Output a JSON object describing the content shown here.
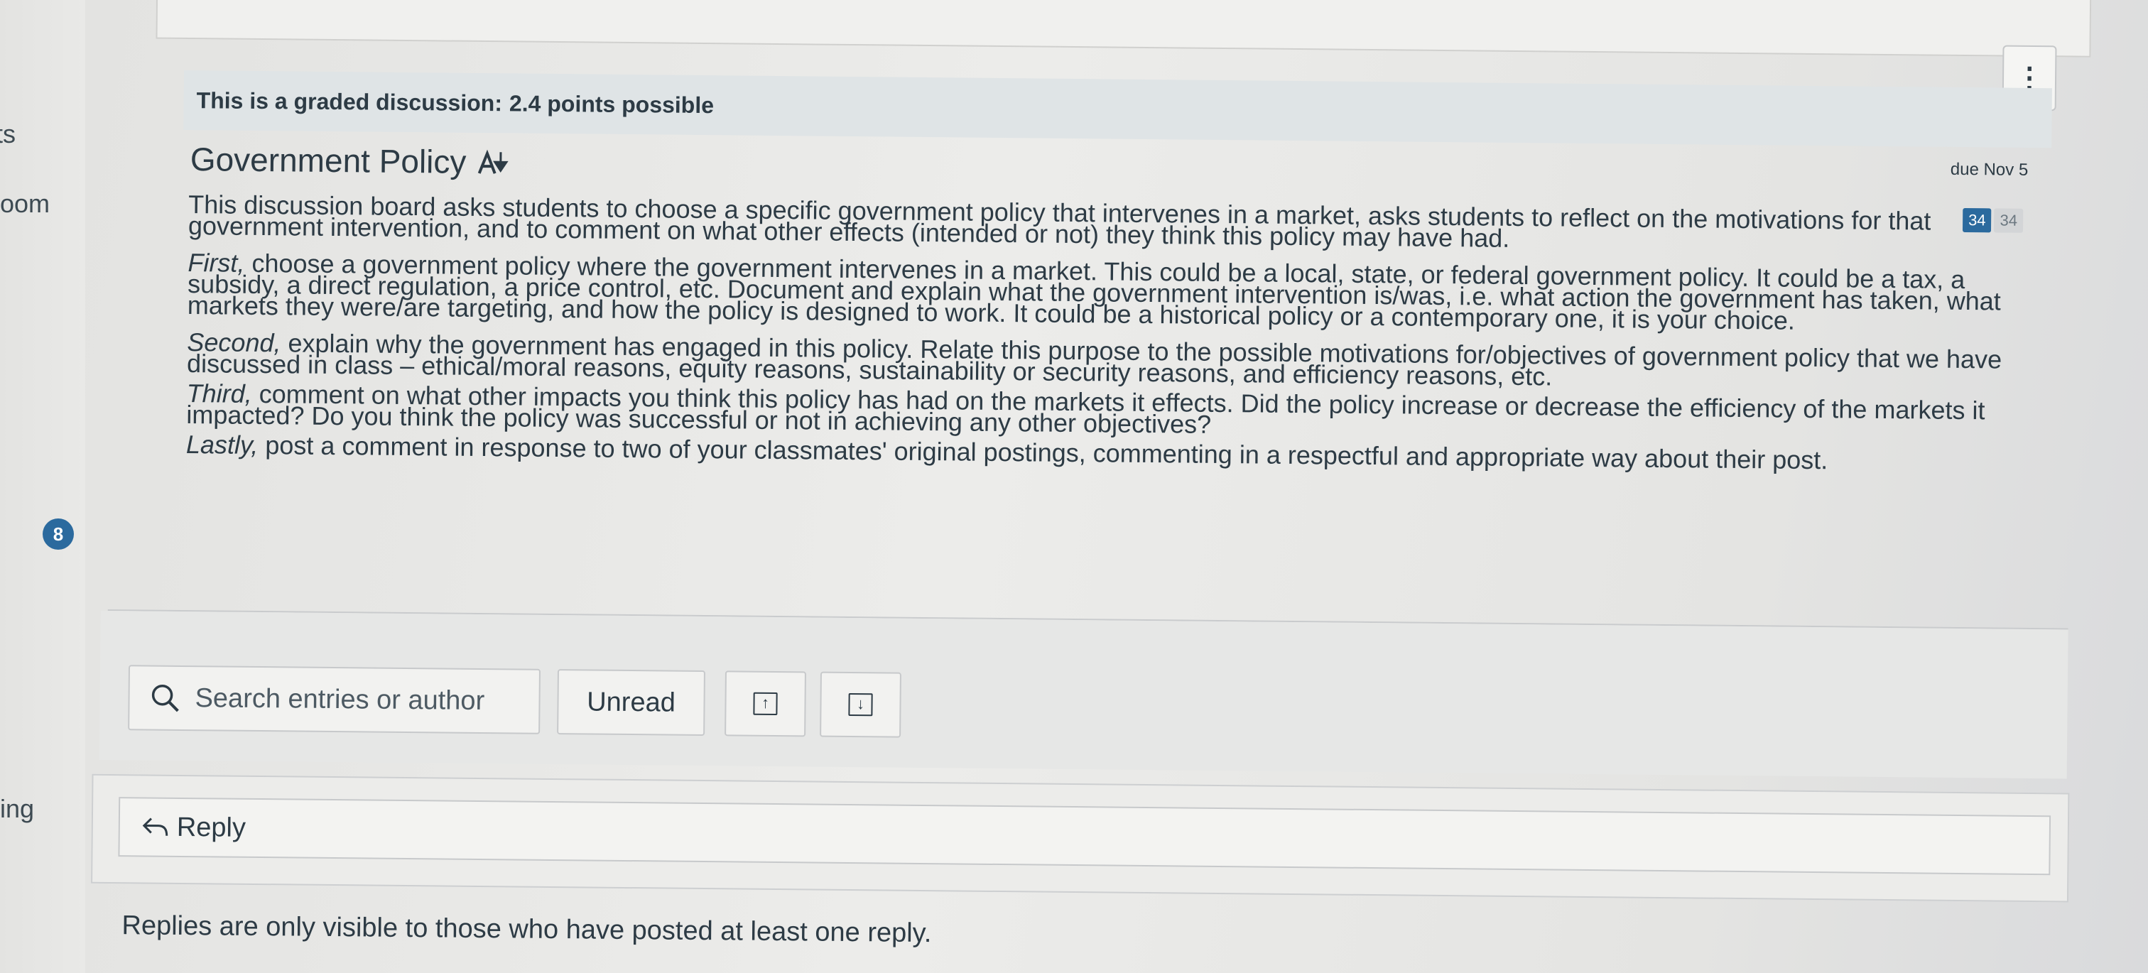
{
  "left_nav": {
    "frag_1": "ts",
    "frag_2": "oom",
    "frag_3": "ing",
    "badge_count": "8"
  },
  "discussion": {
    "graded_banner_prefix": "This is a graded discussion:",
    "graded_banner_points": "2.4 points possible",
    "title": "Government Policy",
    "due": "due Nov 5",
    "unread_count": "34",
    "total_count": "34",
    "paragraphs": [
      {
        "lead": "",
        "text": "This discussion board asks students to choose a specific government policy that intervenes in a market, asks students to reflect on the motivations for that government intervention, and to comment on what other effects (intended or not) they think this policy may have had."
      },
      {
        "lead": "First,",
        "text": " choose a government policy where the government intervenes in a market. This could be a local, state, or federal government policy. It could be a tax, a subsidy, a direct regulation, a price control, etc. Document and explain what the government intervention is/was, i.e. what action the government has taken, what markets they were/are targeting, and how the policy is designed to work. It could be a historical policy or a contemporary one, it is your choice."
      },
      {
        "lead": "Second,",
        "text": " explain why the government has engaged in this policy. Relate this purpose to the possible motivations for/objectives of government policy that we have discussed in class – ethical/moral reasons, equity reasons, sustainability or security reasons, and efficiency reasons, etc."
      },
      {
        "lead": "Third,",
        "text": " comment on what other impacts you think this policy has had on the markets it effects. Did the policy increase or decrease the efficiency of the markets it impacted? Do you think the policy was successful or not in achieving any other objectives?"
      },
      {
        "lead": "Lastly,",
        "text": " post a comment in response to two of your classmates' original postings, commenting in a respectful and appropriate way about their post."
      }
    ]
  },
  "toolbar": {
    "search_placeholder": "Search entries or author",
    "unread_label": "Unread",
    "up_label": "↑",
    "down_label": "↓"
  },
  "reply": {
    "label": "Reply",
    "note": "Replies are only visible to those who have posted at least one reply."
  },
  "colors": {
    "accent": "#2b6a9e",
    "text": "#2d3b45"
  },
  "icons": [
    "kebab-menu-icon",
    "sort-icon",
    "search-icon",
    "arrow-up-icon",
    "arrow-down-icon",
    "reply-icon"
  ]
}
